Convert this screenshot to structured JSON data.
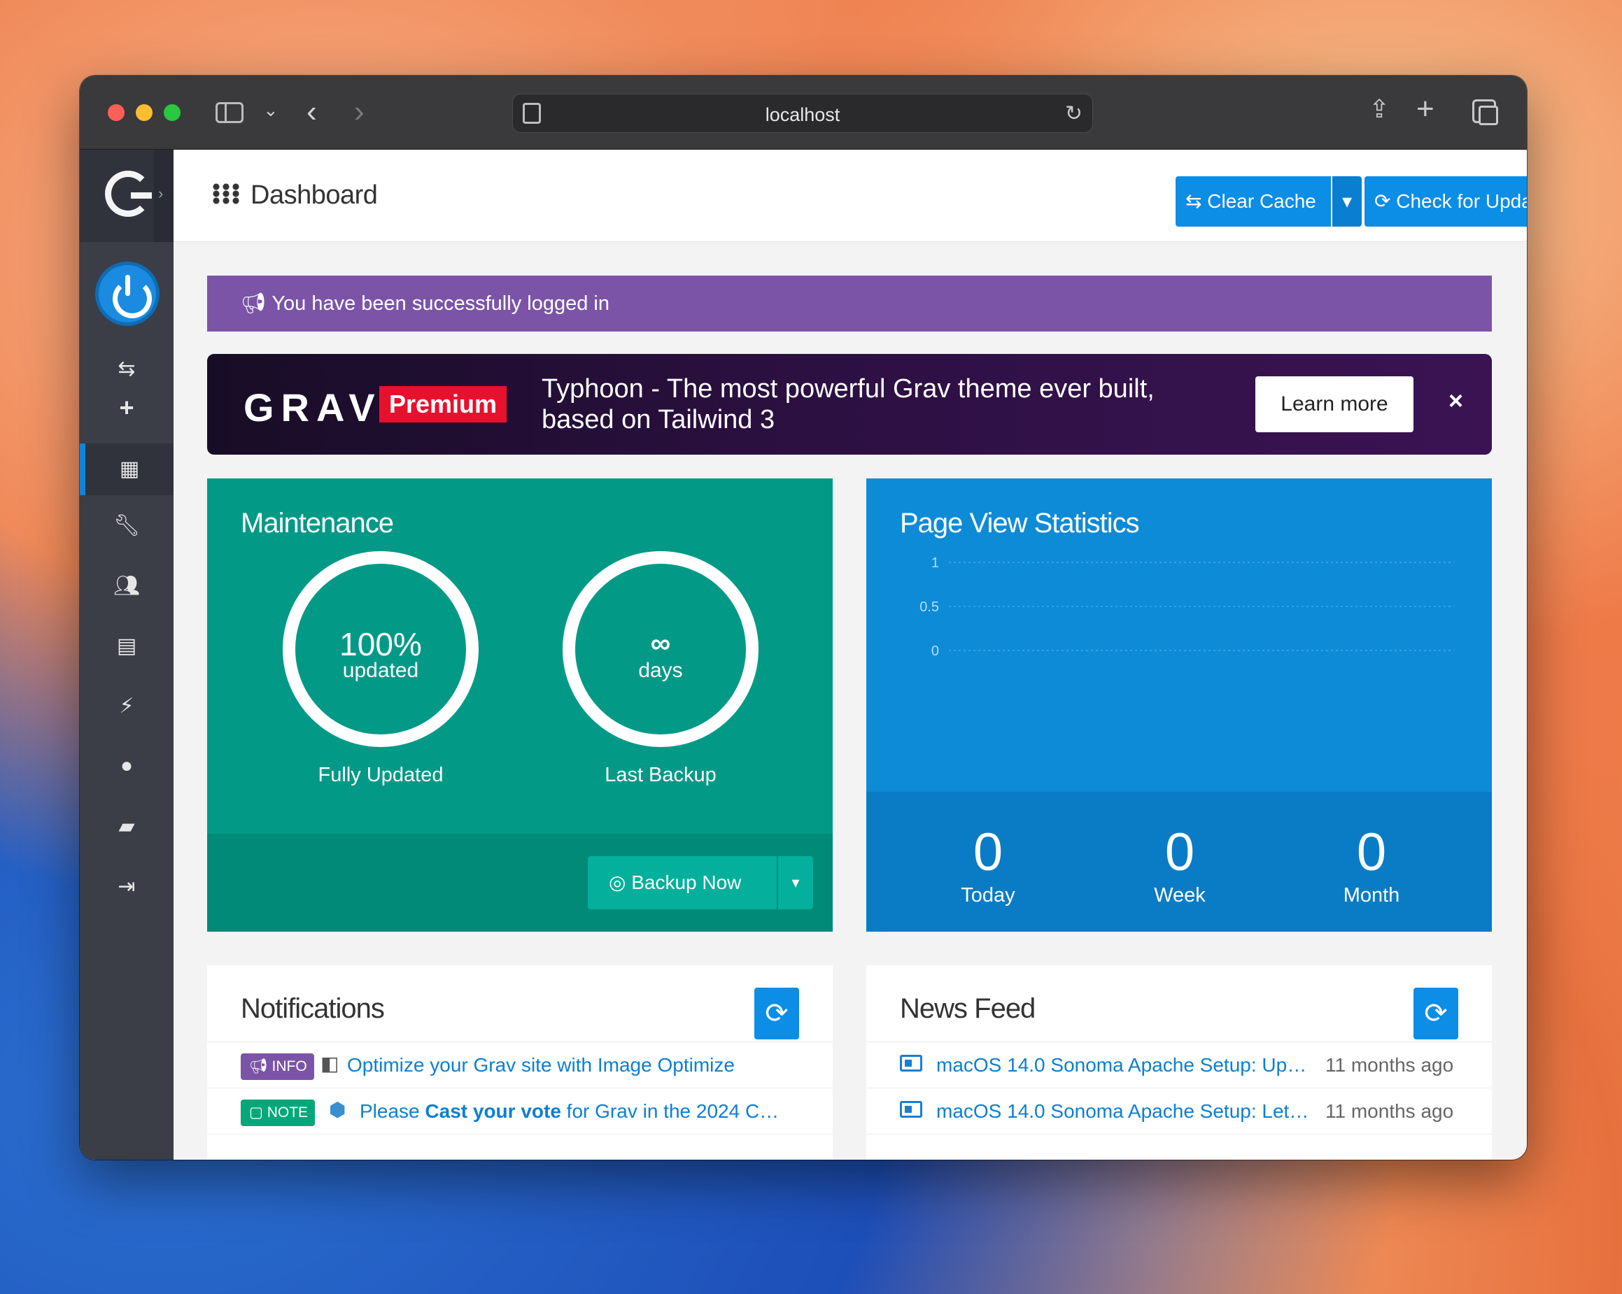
{
  "browser": {
    "url": "localhost"
  },
  "header": {
    "title": "Dashboard",
    "clear_cache_label": "Clear Cache",
    "check_updates_label": "Check for Updates"
  },
  "alert": {
    "message": "You have been successfully logged in"
  },
  "premium": {
    "brand": "GRAV",
    "badge": "Premium",
    "text": "Typhoon - The most powerful Grav theme ever built, based on Tailwind 3",
    "learn_more": "Learn more",
    "close": "×"
  },
  "maintenance": {
    "title": "Maintenance",
    "updated_value": "100%",
    "updated_sub": "updated",
    "updated_label": "Fully Updated",
    "backup_value": "∞",
    "backup_sub": "days",
    "backup_label": "Last Backup",
    "backup_button": "Backup Now"
  },
  "stats": {
    "title": "Page View Statistics",
    "today_value": "0",
    "today_label": "Today",
    "week_value": "0",
    "week_label": "Week",
    "month_value": "0",
    "month_label": "Month"
  },
  "chart_data": {
    "type": "line",
    "title": "Page View Statistics",
    "yticks": [
      "1",
      "0.5",
      "0"
    ],
    "ylim": [
      0,
      1
    ],
    "series": [],
    "grid": true
  },
  "notifications": {
    "title": "Notifications",
    "items": [
      {
        "badge": "INFO",
        "text": "Optimize your Grav site with Image Optimize"
      },
      {
        "badge": "NOTE",
        "text_pre": "Please ",
        "text_bold": "Cast your vote",
        "text_post": " for Grav in the 2024 C…"
      }
    ]
  },
  "news": {
    "title": "News Feed",
    "items": [
      {
        "title": "macOS 14.0 Sonoma Apache Setup: Up…",
        "time": "11 months ago"
      },
      {
        "title": "macOS 14.0 Sonoma Apache Setup: Let…",
        "time": "11 months ago"
      }
    ]
  },
  "colors": {
    "primary": "#0c8de6",
    "maintenance": "#029a87",
    "stats": "#0d8bd7",
    "alert": "#7b54a8",
    "premium_badge": "#e8112d"
  }
}
